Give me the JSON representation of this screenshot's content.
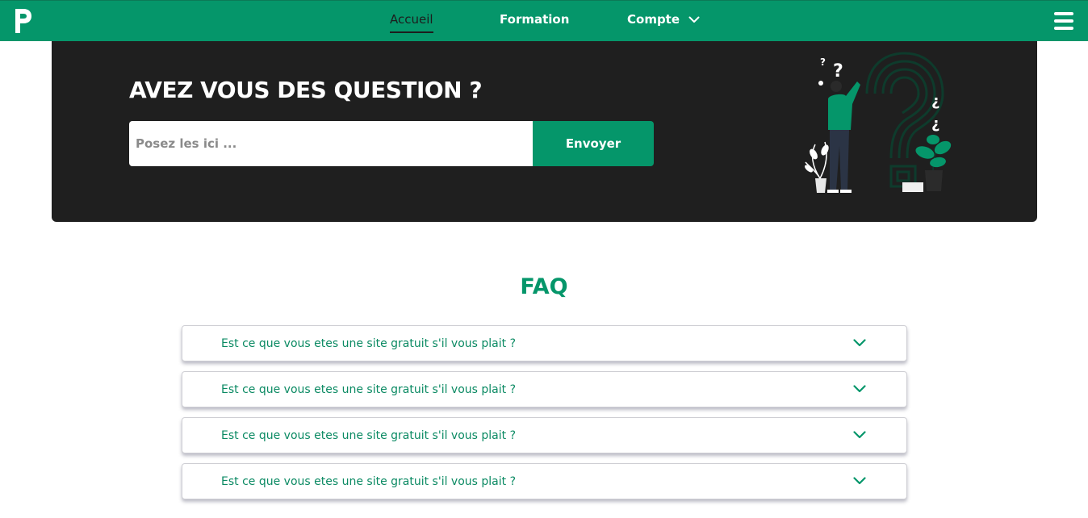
{
  "header": {
    "logo_letter": "P",
    "nav": [
      {
        "label": "Accueil",
        "active": true
      },
      {
        "label": "Formation",
        "active": false
      },
      {
        "label": "Compte",
        "active": false,
        "has_dropdown": true
      }
    ],
    "menu_icon": "hamburger-menu-icon"
  },
  "hero": {
    "title": "AVEZ VOUS DES QUESTION ?",
    "input_placeholder": "Posez les ici ...",
    "input_value": "",
    "send_label": "Envoyer",
    "illustration": "man-drawing-question-mark-maze-illustration"
  },
  "faq": {
    "title": "FAQ",
    "items": [
      {
        "question": "Est ce que vous etes une site gratuit s'il vous plait ?",
        "icon": "chevron-down-icon"
      },
      {
        "question": "Est ce que vous etes une site gratuit s'il vous plait ?",
        "icon": "chevron-down-icon"
      },
      {
        "question": "Est ce que vous etes une site gratuit s'il vous plait ?",
        "icon": "chevron-down-icon"
      },
      {
        "question": "Est ce que vous etes une site gratuit s'il vous plait ?",
        "icon": "chevron-down-icon"
      }
    ]
  },
  "colors": {
    "brand_green": "#05966a",
    "hero_dark": "#1f1f1f",
    "text_dark": "#1d1d1d",
    "white": "#ffffff"
  }
}
